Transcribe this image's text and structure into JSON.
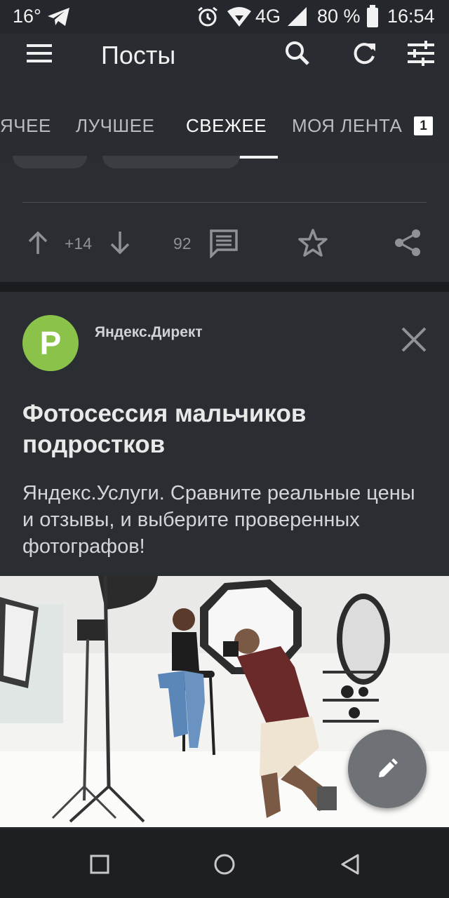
{
  "status_bar": {
    "temperature": "16°",
    "network": "4G",
    "battery": "80 %",
    "time": "16:54"
  },
  "header": {
    "title": "Посты",
    "icons": [
      "menu-icon",
      "search-icon",
      "refresh-icon",
      "filter-icon"
    ]
  },
  "tabs": [
    {
      "label": "ЯЧЕЕ",
      "active": false
    },
    {
      "label": "ЛУЧШЕЕ",
      "active": false
    },
    {
      "label": "СВЕЖЕЕ",
      "active": true
    },
    {
      "label": "МОЯ ЛЕНТА",
      "active": false,
      "badge": "1"
    }
  ],
  "post_actions": {
    "rating": "+14",
    "comments": "92"
  },
  "ad": {
    "avatar_letter": "P",
    "source": "Яндекс.Директ",
    "title": "Фотосессия мальчиков подростков",
    "description": "Яндекс.Услуги. Сравните реальные цены и отзывы, и выберите проверенных фотографов!"
  },
  "colors": {
    "background": "#24272c",
    "card": "#2a2d32",
    "avatar": "#8bc34a",
    "fab": "#6e7175"
  }
}
